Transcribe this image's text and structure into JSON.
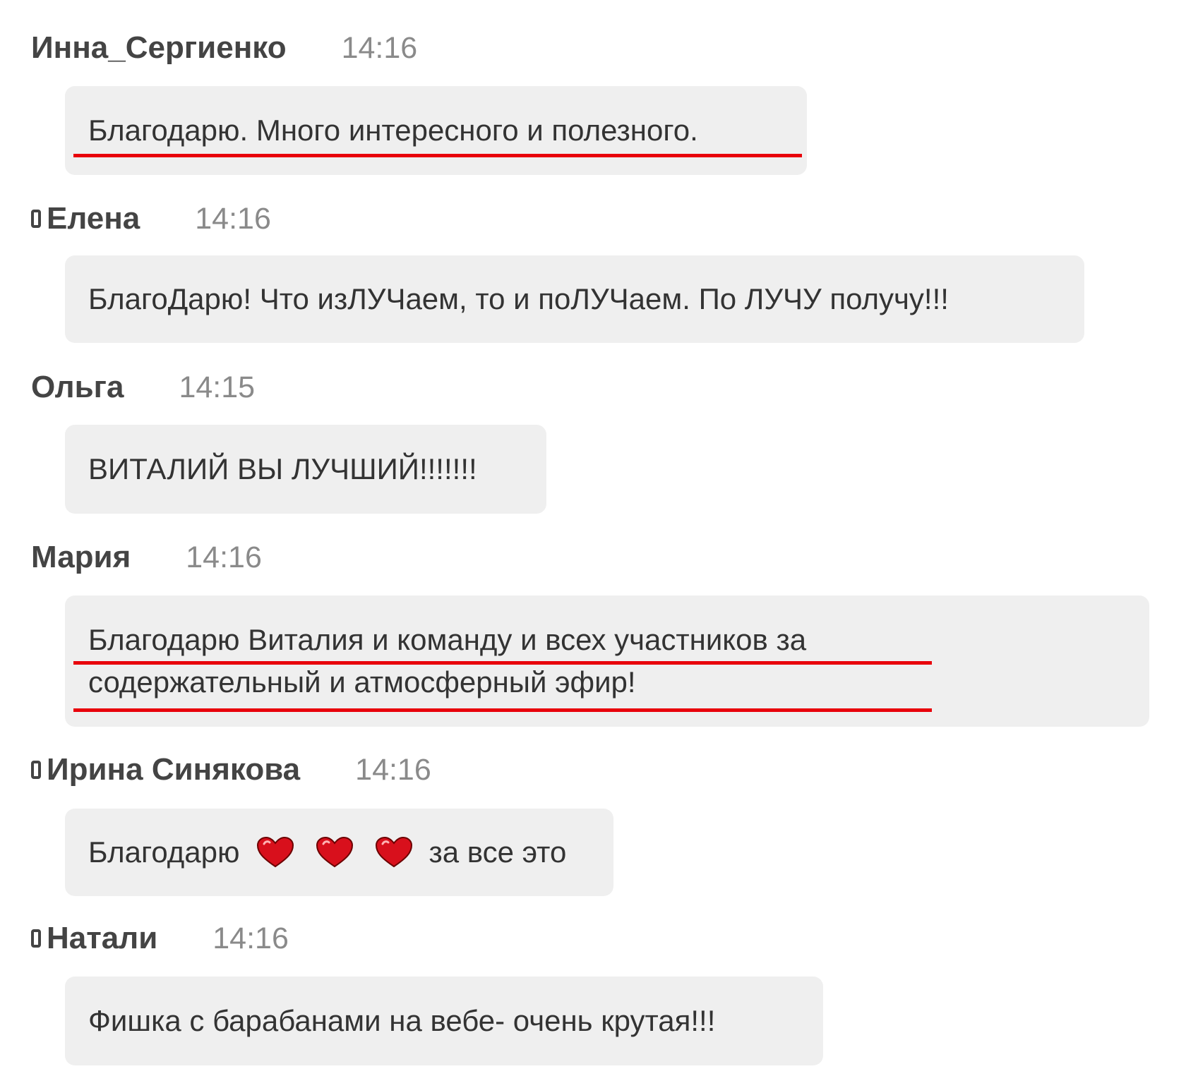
{
  "messages": [
    {
      "author": "Инна_Сергиенко",
      "time": "14:16",
      "mobile": false,
      "text": "Благодарю. Много интересного и полезного."
    },
    {
      "author": "Елена",
      "time": "14:16",
      "mobile": true,
      "text": "БлагоДарю! Что изЛУЧаем, то и поЛУЧаем. По ЛУЧУ получу!!!"
    },
    {
      "author": "Ольга",
      "time": "14:15",
      "mobile": false,
      "text": "ВИТАЛИЙ ВЫ ЛУЧШИЙ!!!!!!!"
    },
    {
      "author": "Мария",
      "time": "14:16",
      "mobile": false,
      "lines": [
        "Благодарю Виталия и команду и всех участников за",
        "содержательный и атмосферный эфир!"
      ]
    },
    {
      "author": "Ирина Синякова",
      "time": "14:16",
      "mobile": true,
      "text_before": "Благодарю",
      "emoji": [
        "heart-icon",
        "heart-icon",
        "heart-icon"
      ],
      "text_after": "за все это"
    },
    {
      "author": "Натали",
      "time": "14:16",
      "mobile": true,
      "text": "Фишка с барабанами на вебе- очень крутая!!!"
    }
  ],
  "colors": {
    "bubble": "#efefef",
    "author": "#444444",
    "time": "#8a8a8a",
    "text": "#333333",
    "highlight_underline": "#e8000b",
    "heart": "#d8101c"
  },
  "annotations": {
    "underlined_messages": [
      0,
      3
    ]
  }
}
